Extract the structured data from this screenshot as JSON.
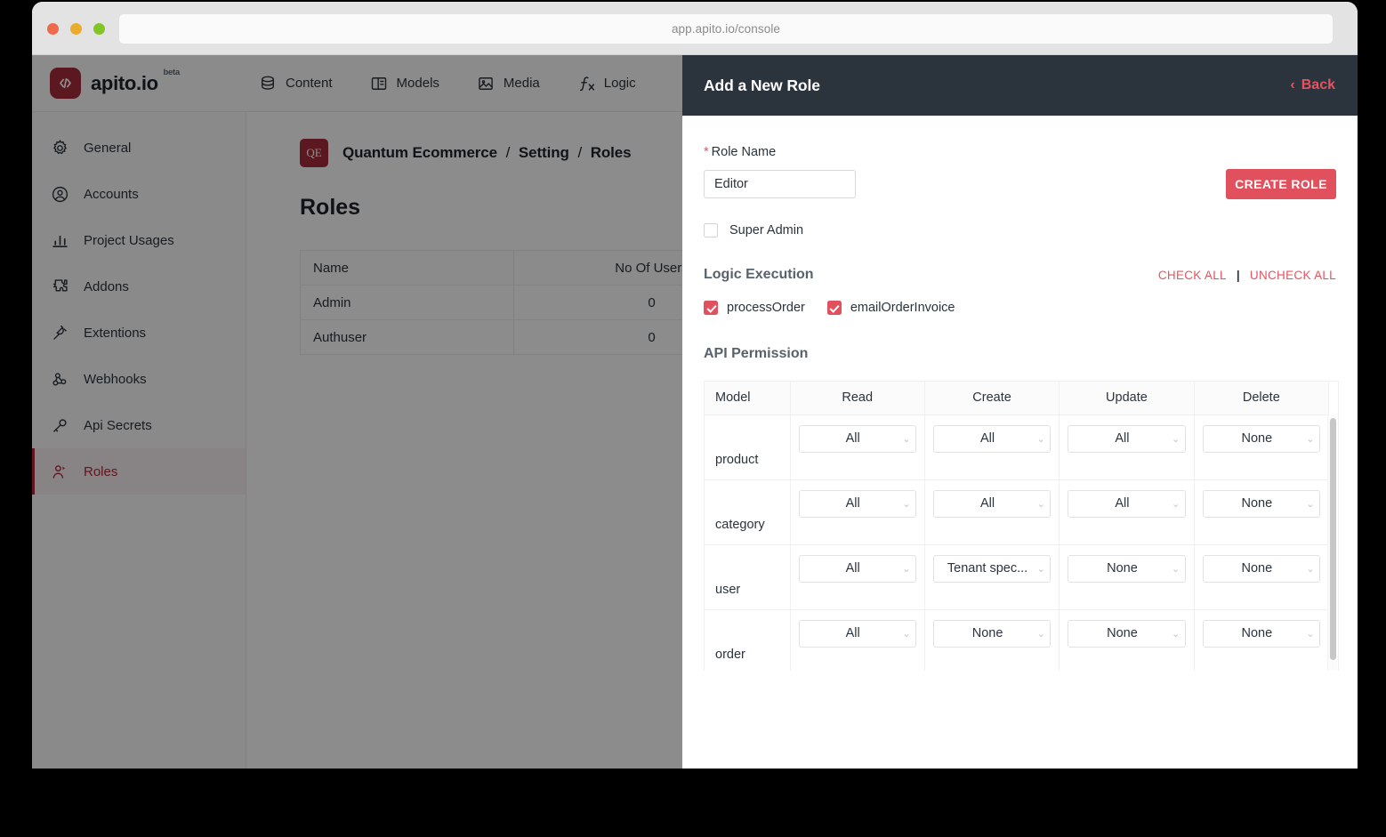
{
  "browser": {
    "url": "app.apito.io/console",
    "traffic_lights": [
      "close-red",
      "minimize-yellow",
      "maximize-green"
    ]
  },
  "brand": {
    "logo_glyph": "</>",
    "name": "apito.io",
    "beta_tag": "beta"
  },
  "topnav": {
    "items": [
      {
        "label": "Content",
        "icon": "database-icon"
      },
      {
        "label": "Models",
        "icon": "layout-columns-icon"
      },
      {
        "label": "Media",
        "icon": "image-icon"
      },
      {
        "label": "Logic",
        "icon": "function-fx-icon"
      }
    ]
  },
  "sidebar": {
    "items": [
      {
        "label": "General",
        "icon": "gear-icon",
        "active": false
      },
      {
        "label": "Accounts",
        "icon": "user-circle-icon",
        "active": false
      },
      {
        "label": "Project Usages",
        "icon": "bar-chart-icon",
        "active": false
      },
      {
        "label": "Addons",
        "icon": "puzzle-icon",
        "active": false
      },
      {
        "label": "Extentions",
        "icon": "plug-icon",
        "active": false
      },
      {
        "label": "Webhooks",
        "icon": "webhook-icon",
        "active": false
      },
      {
        "label": "Api Secrets",
        "icon": "key-icon",
        "active": false
      },
      {
        "label": "Roles",
        "icon": "user-role-icon",
        "active": true
      }
    ]
  },
  "main": {
    "project_badge": "QE",
    "breadcrumb": [
      "Quantum Ecommerce",
      "Setting",
      "Roles"
    ],
    "page_title": "Roles",
    "roles_table": {
      "columns": [
        "Name",
        "No Of Users"
      ],
      "rows": [
        {
          "name": "Admin",
          "users": "0"
        },
        {
          "name": "Authuser",
          "users": "0"
        }
      ]
    }
  },
  "panel": {
    "title": "Add a New Role",
    "back_label": "Back",
    "back_icon": "chevron-left-icon",
    "role_name": {
      "label": "Role Name",
      "required": true,
      "value": "Editor",
      "placeholder": "Role Name"
    },
    "create_button": "CREATE ROLE",
    "super_admin": {
      "label": "Super Admin",
      "checked": false
    },
    "logic_execution": {
      "title": "Logic Execution",
      "check_all": "CHECK ALL",
      "uncheck_all": "UNCHECK ALL",
      "divider": "|",
      "items": [
        {
          "label": "processOrder",
          "checked": true
        },
        {
          "label": "emailOrderInvoice",
          "checked": true
        }
      ]
    },
    "api_permission": {
      "title": "API Permission",
      "columns": [
        "Model",
        "Read",
        "Create",
        "Update",
        "Delete"
      ],
      "rows": [
        {
          "model": "product",
          "read": "All",
          "create": "All",
          "update": "All",
          "delete": "None"
        },
        {
          "model": "category",
          "read": "All",
          "create": "All",
          "update": "All",
          "delete": "None"
        },
        {
          "model": "user",
          "read": "All",
          "create": "Tenant spec...",
          "update": "None",
          "delete": "None"
        },
        {
          "model": "order",
          "read": "All",
          "create": "None",
          "update": "None",
          "delete": "None"
        }
      ]
    }
  },
  "colors": {
    "brand_red": "#a82d3c",
    "accent_red": "#e0505d",
    "panel_header_dark": "#2b333d",
    "active_sidebar_text": "#b2273b"
  }
}
